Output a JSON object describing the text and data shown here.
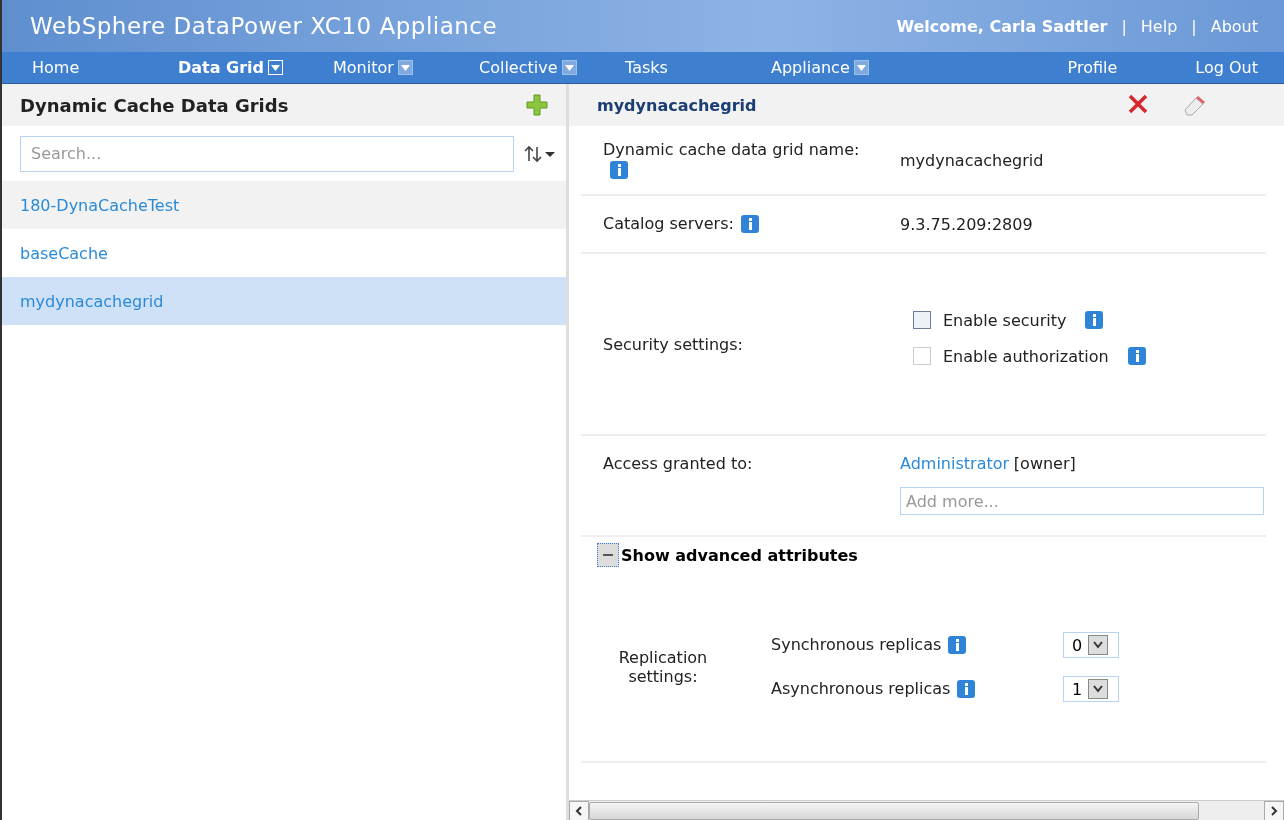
{
  "app_title": "WebSphere DataPower XC10 Appliance",
  "user_links": [
    {
      "kind": "text",
      "label": "Welcome, Carla Sadtler"
    },
    {
      "kind": "sep",
      "label": "|"
    },
    {
      "kind": "link",
      "label": "Help"
    },
    {
      "kind": "sep",
      "label": "|"
    },
    {
      "kind": "link",
      "label": "About"
    }
  ],
  "menu": [
    {
      "label": "Home",
      "dropdown": false,
      "selected": false
    },
    {
      "label": "Data Grid",
      "dropdown": true,
      "selected": true
    },
    {
      "label": "Monitor",
      "dropdown": true,
      "selected": false
    },
    {
      "label": "Collective",
      "dropdown": true,
      "selected": false
    },
    {
      "label": "Tasks",
      "dropdown": false,
      "selected": false
    },
    {
      "label": "Appliance",
      "dropdown": true,
      "selected": false
    }
  ],
  "menu_right": [
    "Profile",
    "Log Out"
  ],
  "sidebar": {
    "title": "Dynamic Cache Data Grids",
    "search": {
      "placeholder": "Search..."
    },
    "items": [
      {
        "label": "180-DynaCacheTest",
        "selected": false
      },
      {
        "label": "baseCache",
        "selected": false
      },
      {
        "label": "mydynacachegrid",
        "selected": true
      }
    ]
  },
  "detail": {
    "title": "mydynacachegrid",
    "name_label": "Dynamic cache data grid name:",
    "name_value": "mydynacachegrid",
    "catalog_label": "Catalog servers:",
    "catalog_value": "9.3.75.209:2809",
    "security_label": "Security settings:",
    "security_options": [
      {
        "label": "Enable security",
        "checked": false,
        "disabled": false
      },
      {
        "label": "Enable authorization",
        "checked": false,
        "disabled": true
      }
    ],
    "access_label": "Access granted to:",
    "access_user": "Administrator",
    "access_role": "[owner]",
    "access_field": {
      "placeholder": "Add more..."
    },
    "advanced": {
      "label": "Show advanced attributes",
      "expanded": true
    },
    "replication_label": "Replication settings:",
    "replicas": [
      {
        "label": "Synchronous replicas",
        "value": "0"
      },
      {
        "label": "Asynchronous replicas",
        "value": "1"
      }
    ]
  }
}
